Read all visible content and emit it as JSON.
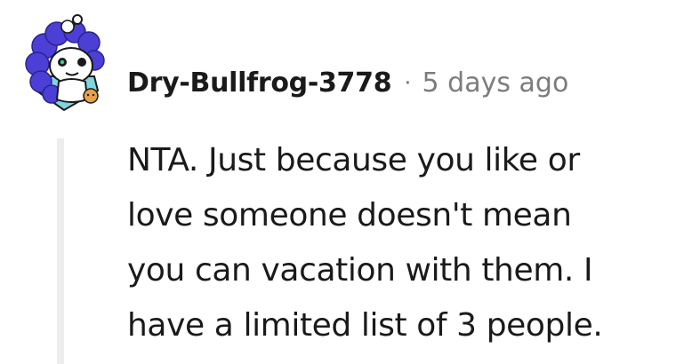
{
  "comment": {
    "username": "Dry-Bullfrog-3778",
    "separator": "·",
    "timestamp": "5 days ago",
    "avatar_icon": "reddit-snoo-avatar-icon",
    "body_lines": [
      "NTA. Just because you like or",
      "love someone doesn't mean",
      "you can vacation with them. I",
      "have a limited list of 3 people."
    ]
  },
  "colors": {
    "text": "#1a1a1b",
    "muted": "#7c7c7c",
    "thread_line": "#ededed",
    "avatar_hair": "#4b3fd6",
    "avatar_base": "#7fd6dc"
  }
}
